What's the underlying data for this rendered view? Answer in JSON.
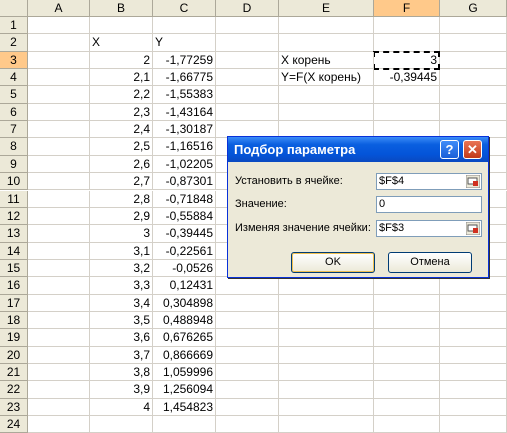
{
  "columns": [
    "A",
    "B",
    "C",
    "D",
    "E",
    "F",
    "G"
  ],
  "rows": [
    "1",
    "2",
    "3",
    "4",
    "5",
    "6",
    "7",
    "8",
    "9",
    "10",
    "11",
    "12",
    "13",
    "14",
    "15",
    "16",
    "17",
    "18",
    "19",
    "20",
    "21",
    "22",
    "23",
    "24"
  ],
  "selected_column": "F",
  "selected_row": "3",
  "cells": {
    "B2": "X",
    "C2": "Y",
    "B3": "2",
    "C3": "-1,77259",
    "B4": "2,1",
    "C4": "-1,66775",
    "B5": "2,2",
    "C5": "-1,55383",
    "B6": "2,3",
    "C6": "-1,43164",
    "B7": "2,4",
    "C7": "-1,30187",
    "B8": "2,5",
    "C8": "-1,16516",
    "B9": "2,6",
    "C9": "-1,02205",
    "B10": "2,7",
    "C10": "-0,87301",
    "B11": "2,8",
    "C11": "-0,71848",
    "B12": "2,9",
    "C12": "-0,55884",
    "B13": "3",
    "C13": "-0,39445",
    "B14": "3,1",
    "C14": "-0,22561",
    "B15": "3,2",
    "C15": "-0,0526",
    "B16": "3,3",
    "C16": "0,12431",
    "B17": "3,4",
    "C17": "0,304898",
    "B18": "3,5",
    "C18": "0,488948",
    "B19": "3,6",
    "C19": "0,676265",
    "B20": "3,7",
    "C20": "0,866669",
    "B21": "3,8",
    "C21": "1,059996",
    "B22": "3,9",
    "C22": "1,256094",
    "B23": "4",
    "C23": "1,454823",
    "E3": "X корень",
    "F3": "3",
    "E4": "Y=F(X корень)",
    "F4": "-0,39445"
  },
  "dialog": {
    "title": "Подбор параметра",
    "help_glyph": "?",
    "close_glyph": "✕",
    "set_cell_label": "Установить в ячейке:",
    "set_cell_value": "$F$4",
    "to_value_label": "Значение:",
    "to_value_value": "0",
    "changing_cell_label": "Изменяя значение ячейки:",
    "changing_cell_value": "$F$3",
    "ok_label": "OK",
    "cancel_label": "Отмена"
  },
  "colors": {
    "title_bar": "#0a5fe0",
    "header_bg": "#ece9d8",
    "header_selected": "#ffc98a",
    "dialog_bg": "#ece9d8"
  }
}
